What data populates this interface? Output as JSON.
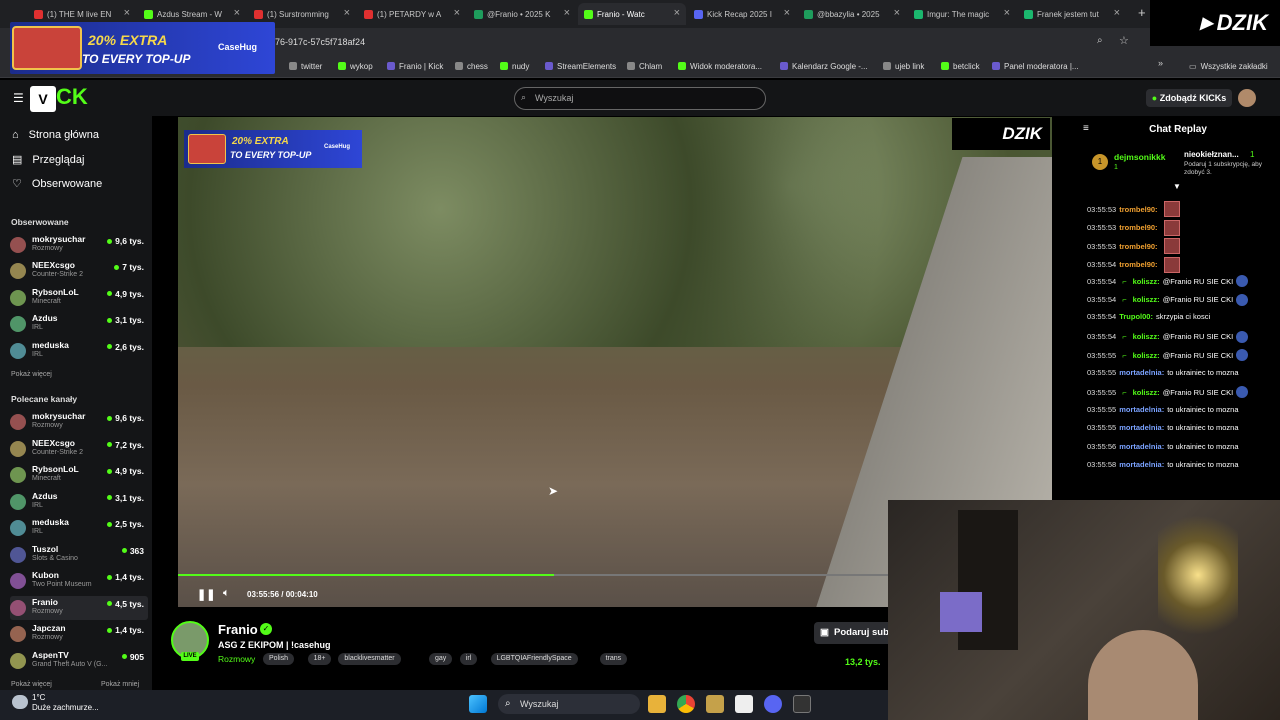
{
  "browser": {
    "tabs": [
      {
        "label": "(1) THE M live EN",
        "color": "#e03030"
      },
      {
        "label": "Azdus Stream - W",
        "color": "#53fc18"
      },
      {
        "label": "(1) Surstromming",
        "color": "#e03030"
      },
      {
        "label": "(1) PETARDY w A",
        "color": "#e03030"
      },
      {
        "label": "@Franio • 2025 K",
        "color": "#1e9c5c"
      },
      {
        "label": "Franio - Watc",
        "color": "#53fc18",
        "active": true
      },
      {
        "label": "Kick Recap 2025 I",
        "color": "#5865f2"
      },
      {
        "label": "@bbazylia • 2025",
        "color": "#1e9c5c"
      },
      {
        "label": "Imgur: The magic",
        "color": "#1bb76e"
      },
      {
        "label": "Franek jestem tut",
        "color": "#1bb76e"
      }
    ],
    "url": "76-917c-57c5f718af24",
    "bookmarks": [
      {
        "label": "twitter"
      },
      {
        "label": "wykop"
      },
      {
        "label": "Franio | Kick"
      },
      {
        "label": "chess"
      },
      {
        "label": "nudy"
      },
      {
        "label": "StreamElements"
      },
      {
        "label": "Chlam"
      },
      {
        "label": "Widok moderatora..."
      },
      {
        "label": "Kalendarz Google -..."
      },
      {
        "label": "ujeb link"
      },
      {
        "label": "betclick"
      },
      {
        "label": "Panel moderatora |..."
      }
    ],
    "all_bookmarks": "Wszystkie zakładki"
  },
  "ad": {
    "extra": "20% EXTRA",
    "every": "TO EVERY TOP-UP",
    "brand": "CaseHug"
  },
  "overlay": {
    "dzik": "DZIK"
  },
  "header": {
    "search_placeholder": "Wyszukaj",
    "kicks_button": "Zdobądź KICKs"
  },
  "nav": [
    {
      "label": "Strona główna",
      "icon": "home-icon"
    },
    {
      "label": "Przeglądaj",
      "icon": "browse-icon"
    },
    {
      "label": "Obserwowane",
      "icon": "heart-icon"
    }
  ],
  "followed": {
    "title": "Obserwowane",
    "channels": [
      {
        "name": "mokrysuchar",
        "category": "Rozmowy",
        "viewers": "9,6 tys."
      },
      {
        "name": "NEEXcsgo",
        "category": "Counter-Strike 2",
        "viewers": "7 tys."
      },
      {
        "name": "RybsonLoL",
        "category": "Minecraft",
        "viewers": "4,9 tys."
      },
      {
        "name": "Azdus",
        "category": "IRL",
        "viewers": "3,1 tys."
      },
      {
        "name": "meduska",
        "category": "IRL",
        "viewers": "2,6 tys."
      }
    ],
    "more": "Pokaż więcej"
  },
  "recommended": {
    "title": "Polecane kanały",
    "channels": [
      {
        "name": "mokrysuchar",
        "category": "Rozmowy",
        "viewers": "9,6 tys."
      },
      {
        "name": "NEEXcsgo",
        "category": "Counter-Strike 2",
        "viewers": "7,2 tys."
      },
      {
        "name": "RybsonLoL",
        "category": "Minecraft",
        "viewers": "4,9 tys."
      },
      {
        "name": "Azdus",
        "category": "IRL",
        "viewers": "3,1 tys."
      },
      {
        "name": "meduska",
        "category": "IRL",
        "viewers": "2,5 tys."
      },
      {
        "name": "Tuszol",
        "category": "Slots & Casino",
        "viewers": "363"
      },
      {
        "name": "Kubon",
        "category": "Two Point Museum",
        "viewers": "1,4 tys."
      },
      {
        "name": "Franio",
        "category": "Rozmowy",
        "viewers": "4,5 tys."
      },
      {
        "name": "Japczan",
        "category": "Rozmowy",
        "viewers": "1,4 tys."
      },
      {
        "name": "AspenTV",
        "category": "Grand Theft Auto V (G...",
        "viewers": "905"
      }
    ],
    "more": "Pokaż więcej",
    "less": "Pokaż mniej"
  },
  "video": {
    "ad_extra": "20% EXTRA",
    "ad_every": "TO EVERY TOP-UP",
    "ad_brand": "CaseHug",
    "time": "03:55:56 / 00:04:10",
    "progress": 0.53
  },
  "stream": {
    "streamer": "Franio",
    "live": "LIVE",
    "title": "ASG Z EKIPOM  | !casehug",
    "category": "Rozmowy",
    "tags": [
      "Polish",
      "18+",
      "blacklivesmatter",
      "gay",
      "irl",
      "LGBTQIAFriendlySpace",
      "trans"
    ],
    "subscribe": "Podaruj sub",
    "viewers": "13,2 tys."
  },
  "chat": {
    "title": "Chat Replay",
    "pinned": {
      "user1": "dejmsonikkk",
      "count1": "1",
      "user2": "nieokiełznan...",
      "count2": "1",
      "text": "Podaruj 1 subskrypcję, aby zdobyć 3."
    },
    "messages": [
      {
        "ts": "03:55:53",
        "user": "trombel90:",
        "text": "",
        "color": "#f0a030",
        "emote": true
      },
      {
        "ts": "03:55:53",
        "user": "trombel90:",
        "text": "",
        "color": "#f0a030",
        "emote": true
      },
      {
        "ts": "03:55:53",
        "user": "trombel90:",
        "text": "",
        "color": "#f0a030",
        "emote": true
      },
      {
        "ts": "03:55:54",
        "user": "trombel90:",
        "text": "",
        "color": "#f0a030",
        "emote": true
      },
      {
        "ts": "03:55:54",
        "user": "koliszz:",
        "text": "@Franio RU SIE CKI",
        "color": "#53fc18"
      },
      {
        "ts": "03:55:54",
        "user": "koliszz:",
        "text": "@Franio RU SIE CKI",
        "color": "#53fc18"
      },
      {
        "ts": "03:55:54",
        "user": "Trupol00:",
        "text": "skrzypia ci kosci",
        "color": "#53fc18"
      },
      {
        "ts": "03:55:54",
        "user": "koliszz:",
        "text": "@Franio RU SIE CKI",
        "color": "#53fc18"
      },
      {
        "ts": "03:55:55",
        "user": "koliszz:",
        "text": "@Franio RU SIE CKI",
        "color": "#53fc18"
      },
      {
        "ts": "03:55:55",
        "user": "mortadelnia:",
        "text": "to ukrainiec to mozna",
        "color": "#7aa2ff"
      },
      {
        "ts": "03:55:55",
        "user": "koliszz:",
        "text": "@Franio RU SIE CKI",
        "color": "#53fc18"
      },
      {
        "ts": "03:55:55",
        "user": "mortadelnia:",
        "text": "to ukrainiec to mozna",
        "color": "#7aa2ff"
      },
      {
        "ts": "03:55:55",
        "user": "mortadelnia:",
        "text": "to ukrainiec to mozna",
        "color": "#7aa2ff"
      },
      {
        "ts": "03:55:56",
        "user": "mortadelnia:",
        "text": "to ukrainiec to mozna",
        "color": "#7aa2ff"
      },
      {
        "ts": "03:55:58",
        "user": "mortadelnia:",
        "text": "to ukrainiec to mozna",
        "color": "#7aa2ff"
      }
    ]
  },
  "taskbar": {
    "temp": "1°C",
    "weather": "Duże zachmurze...",
    "search": "Wyszukaj"
  },
  "colors": {
    "accent": "#53fc18",
    "bg": "#000000",
    "panel": "#141517"
  }
}
